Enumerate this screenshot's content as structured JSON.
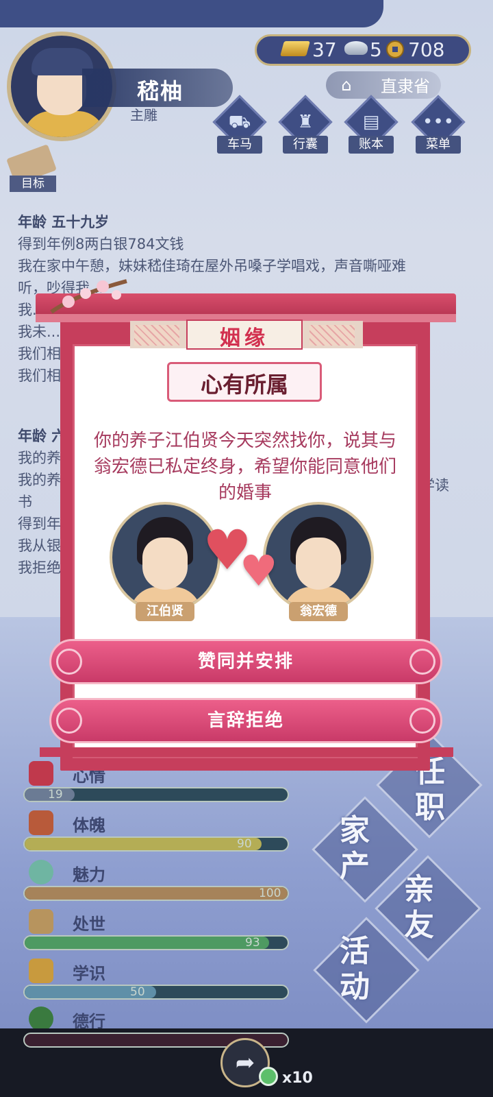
{
  "header": {
    "player_name": "嵇柚",
    "player_role": "主雕",
    "currency": {
      "gold": "37",
      "silver": "5",
      "coins": "708"
    },
    "province": "直隶省",
    "menu": [
      {
        "label": "车马",
        "icon": "carriage-icon"
      },
      {
        "label": "行囊",
        "icon": "bag-icon"
      },
      {
        "label": "账本",
        "icon": "ledger-icon"
      },
      {
        "label": "菜单",
        "icon": "more-icon"
      }
    ],
    "goal_label": "目标"
  },
  "log": {
    "entry1": {
      "age": "年龄 五十九岁",
      "lines": [
        "得到年例8两白银784文钱",
        "我在家中午憩，妹妹嵇佳琦在屋外吊嗓子学唱戏，声音嘶哑难",
        "听，吵得我..."
      ],
      "partial": [
        "我...",
        "我未...",
        "我们相...",
        "我们相..."
      ]
    },
    "entry2": {
      "age": "年龄 六...",
      "lines": [
        "我的养...",
        "我的养...",
        "书",
        "得到年...",
        "我从银...",
        "我拒绝..."
      ],
      "tail": "学读"
    }
  },
  "dialog": {
    "title": "姻缘",
    "subtitle": "心有所属",
    "message": "你的养子江伯贤今天突然找你，说其与翁宏德已私定终身，希望你能同意他们的婚事",
    "person_left": "江伯贤",
    "person_right": "翁宏德",
    "accept_label": "赞同并安排",
    "reject_label": "言辞拒绝"
  },
  "stats": [
    {
      "label": "心情",
      "value": "19",
      "percent": 19,
      "color": "#6b7b94"
    },
    {
      "label": "体魄",
      "value": "90",
      "percent": 90,
      "color": "#b4ad55"
    },
    {
      "label": "魅力",
      "value": "100",
      "percent": 100,
      "color": "#a6835a"
    },
    {
      "label": "处世",
      "value": "93",
      "percent": 93,
      "color": "#4e9a62"
    },
    {
      "label": "学识",
      "value": "50",
      "percent": 50,
      "color": "#5f8fa8"
    },
    {
      "label": "德行",
      "value": "0",
      "percent": 0,
      "color": "#6a3a4a"
    }
  ],
  "side_menu": [
    {
      "label": "任职"
    },
    {
      "label": "家产"
    },
    {
      "label": "亲友"
    },
    {
      "label": "活动"
    }
  ],
  "bottom": {
    "multiplier": "x10"
  }
}
